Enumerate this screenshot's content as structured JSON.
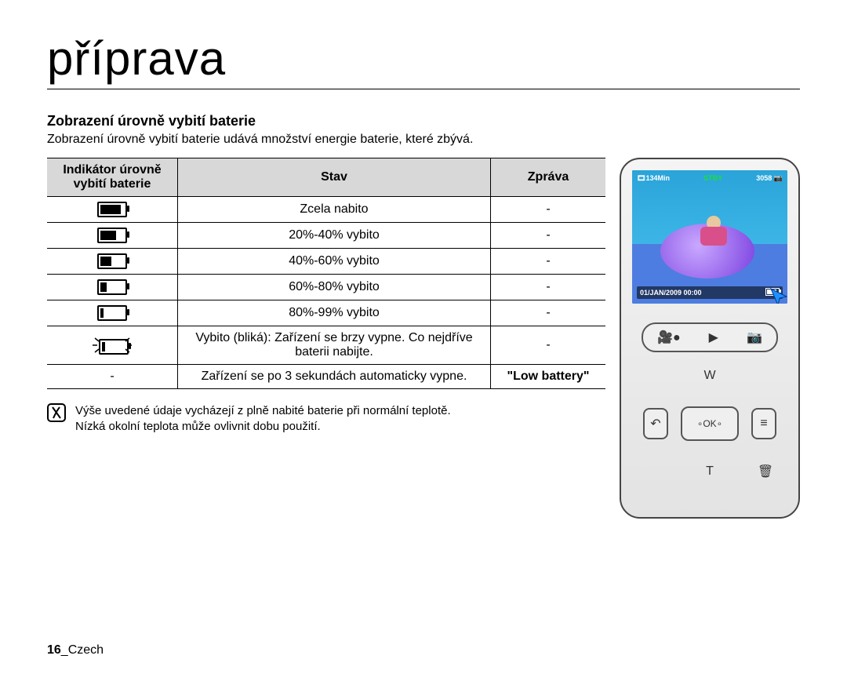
{
  "page_title": "příprava",
  "section_title": "Zobrazení úrovně vybití baterie",
  "section_desc": "Zobrazení úrovně vybití baterie udává množství energie baterie, které zbývá.",
  "table": {
    "headers": {
      "indicator": "Indikátor úrovně vybití baterie",
      "state": "Stav",
      "message": "Zpráva"
    },
    "rows": [
      {
        "indicator_level": 4,
        "state": "Zcela nabito",
        "message": "-"
      },
      {
        "indicator_level": 3,
        "state": "20%-40% vybito",
        "message": "-"
      },
      {
        "indicator_level": 2,
        "state": "40%-60% vybito",
        "message": "-"
      },
      {
        "indicator_level": 1,
        "state": "60%-80% vybito",
        "message": "-"
      },
      {
        "indicator_level": 0,
        "state": "80%-99% vybito",
        "message": "-"
      },
      {
        "indicator_level": "blink",
        "state": "Vybito (bliká): Zařízení se brzy vypne. Co nejdříve baterii nabijte.",
        "message": "-"
      },
      {
        "indicator_level": "-",
        "state": "Zařízení se po 3 sekundách automaticky vypne.",
        "message": "\"Low battery\"",
        "message_bold": true
      }
    ]
  },
  "note": {
    "line1": "Výše uvedené údaje vycházejí z plně nabité baterie při normální teplotě.",
    "line2": "Nízká okolní teplota může ovlivnit dobu použití."
  },
  "device": {
    "top_left": "134Min",
    "top_center": "STBY",
    "top_right": "3058",
    "bottom_left": "01/JAN/2009 00:00",
    "ok_label": "OK",
    "pad_up": "W",
    "pad_down": "T",
    "pad_left_icon": "back-icon",
    "pad_right_icon": "menu-icon",
    "mode_video_icon": "video-icon",
    "mode_play_icon": "play-icon",
    "mode_photo_icon": "camera-icon",
    "trash_icon": "trash-hand-icon"
  },
  "footer": {
    "page_number": "16",
    "lang": "Czech"
  }
}
